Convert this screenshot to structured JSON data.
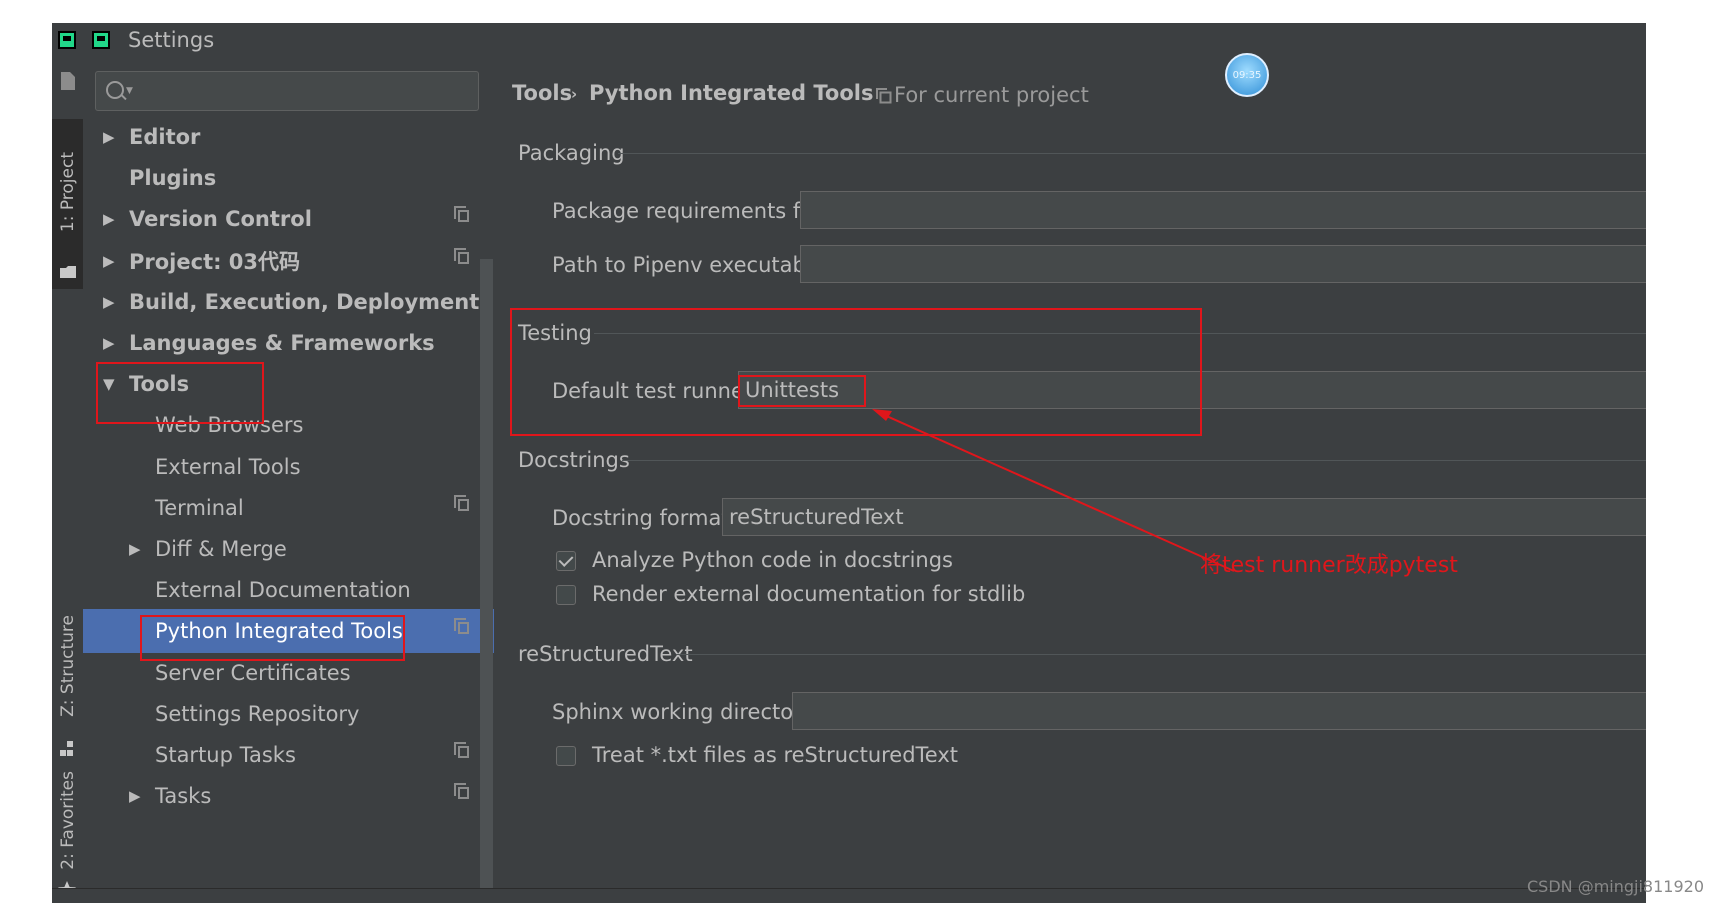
{
  "window": {
    "title": "Settings"
  },
  "toolstrip": {
    "tabs": [
      {
        "label": "1: Project"
      },
      {
        "label": "Z: Structure"
      },
      {
        "label": "2: Favorites"
      }
    ]
  },
  "search": {
    "value": "",
    "placeholder": ""
  },
  "tree": {
    "items": [
      {
        "label": "Editor",
        "bold": true,
        "arrow": "right"
      },
      {
        "label": "Plugins",
        "bold": true
      },
      {
        "label": "Version Control",
        "bold": true,
        "arrow": "right",
        "project_icon": true
      },
      {
        "label": "Project: 03代码",
        "bold": true,
        "arrow": "right",
        "project_icon": true
      },
      {
        "label": "Build, Execution, Deployment",
        "bold": true,
        "arrow": "right"
      },
      {
        "label": "Languages & Frameworks",
        "bold": true,
        "arrow": "right"
      },
      {
        "label": "Tools",
        "bold": true,
        "arrow": "down"
      },
      {
        "label": "Web Browsers"
      },
      {
        "label": "External Tools"
      },
      {
        "label": "Terminal",
        "project_icon": true
      },
      {
        "label": "Diff & Merge",
        "arrow": "right"
      },
      {
        "label": "External Documentation"
      },
      {
        "label": "Python Integrated Tools",
        "selected": true,
        "project_icon": true
      },
      {
        "label": "Server Certificates"
      },
      {
        "label": "Settings Repository"
      },
      {
        "label": "Startup Tasks",
        "project_icon": true
      },
      {
        "label": "Tasks",
        "arrow": "right",
        "project_icon": true
      }
    ]
  },
  "content": {
    "breadcrumb": {
      "parent": "Tools",
      "separator": "›",
      "current": "Python Integrated Tools"
    },
    "scope_label": "For current project",
    "packaging": {
      "title": "Packaging",
      "requirements_label": "Package requirements file:",
      "requirements_value": "",
      "pipenv_label": "Path to Pipenv executable:",
      "pipenv_value": ""
    },
    "testing": {
      "title": "Testing",
      "runner_label": "Default test runner:",
      "runner_value": "Unittests"
    },
    "docstrings": {
      "title": "Docstrings",
      "format_label": "Docstring format:",
      "format_value": "reStructuredText",
      "analyze_label": "Analyze Python code in docstrings",
      "analyze_checked": true,
      "render_label": "Render external documentation for stdlib",
      "render_checked": false
    },
    "rst": {
      "title": "reStructuredText",
      "sphinx_label": "Sphinx working directory:",
      "sphinx_value": "",
      "treat_label": "Treat *.txt files as reStructuredText",
      "treat_checked": false
    }
  },
  "annotation": {
    "text": "将test runner改成pytest",
    "color": "#e0161b"
  },
  "clock": {
    "time": "09:35"
  },
  "watermark": "CSDN @mingji811920",
  "colors": {
    "background": "#3c3f41",
    "selection": "#4b6eaf",
    "text": "#bbbbbb"
  }
}
